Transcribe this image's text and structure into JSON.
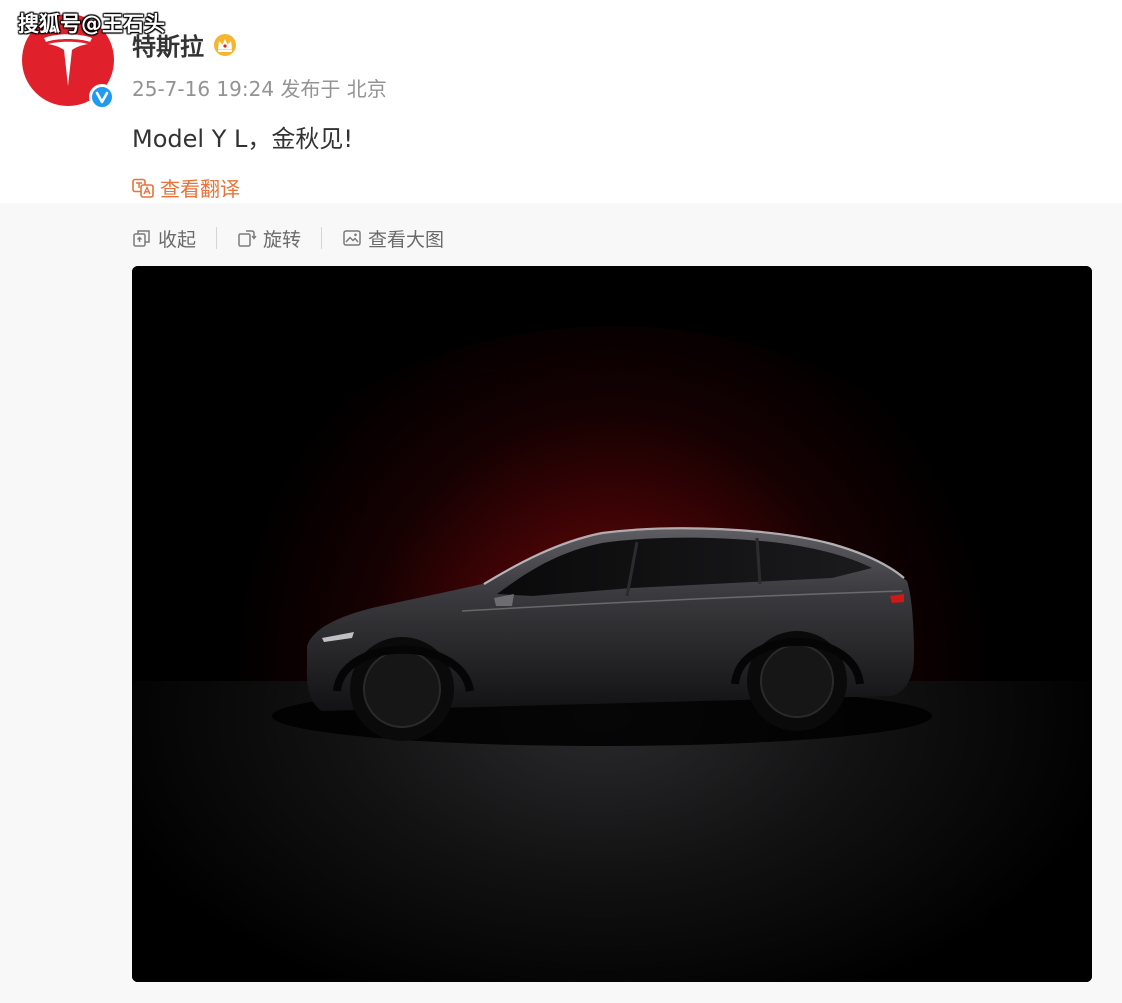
{
  "watermark": "搜狐号@王石头",
  "post": {
    "author": "特斯拉",
    "time": "25-7-16 19:24",
    "published_in": "发布于 北京",
    "text": "Model Y L，金秋见!",
    "translate_label": "查看翻译"
  },
  "toolbar": {
    "collapse_label": "收起",
    "rotate_label": "旋转",
    "view_large_label": "查看大图"
  },
  "colors": {
    "brand_red": "#e0202a",
    "verified_blue": "#1e9bf0",
    "translate_orange": "#e8723a",
    "crown_gold": "#f5b52e"
  },
  "icons": {
    "avatar_logo": "tesla-logo-icon",
    "verified": "verified-badge-icon",
    "member_badge": "crown-badge-icon",
    "translate": "translate-icon",
    "collapse": "collapse-icon",
    "rotate": "rotate-icon",
    "view_large": "view-large-icon"
  }
}
